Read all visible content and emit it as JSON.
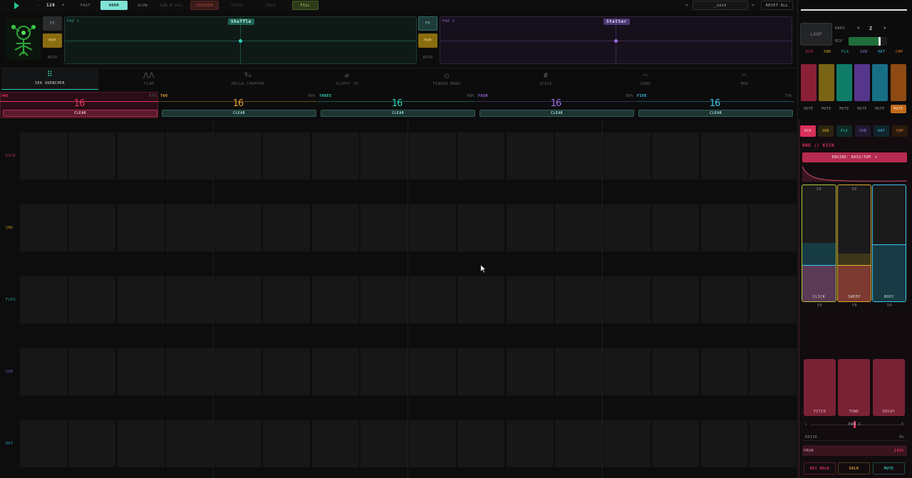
{
  "transport": {
    "play_icon": "play-icon",
    "bpm_minus": "-",
    "bpm": "120",
    "bpm_plus": "+",
    "speed": [
      "FAST",
      "NORM",
      "SLOW"
    ],
    "steps_info": "12& 8 eti.",
    "modes": [
      "CHOSHEN",
      "STROE",
      "PACK"
    ],
    "fill": "FILL",
    "preset_prev": "<",
    "preset_name": "_init",
    "preset_next": "<",
    "reset_all": "RESET ALL"
  },
  "fx": {
    "left": {
      "fx": "FX",
      "mom": "MOM",
      "auto": "AUTO",
      "pad_label": "PAD 1",
      "effect": "Shuffle"
    },
    "right": {
      "fx": "FX",
      "mom": "MOM",
      "auto": "AUTO",
      "pad_label": "PAD 2",
      "effect": "Stutter"
    }
  },
  "tabs": [
    {
      "label": "SEA QUENCHER",
      "icon": "grid-icon",
      "glyph": "⠿"
    },
    {
      "label": "FLAM",
      "icon": "flam-icon",
      "glyph": "⋀⋀"
    },
    {
      "label": "HELLA CHOPPER",
      "icon": "chopper-icon",
      "glyph": "ꟻ⫝"
    },
    {
      "label": "SLOPPY JO",
      "icon": "sloppy-icon",
      "glyph": "⇄"
    },
    {
      "label": "FINGER BANG",
      "icon": "circle-icon",
      "glyph": "○"
    },
    {
      "label": "SCALE",
      "icon": "hash-icon",
      "glyph": "#"
    },
    {
      "label": "SONG",
      "icon": "curve-icon",
      "glyph": "⌒"
    },
    {
      "label": "MOD",
      "icon": "mod-curve-icon",
      "glyph": "⌒"
    }
  ],
  "tracks": [
    {
      "name": "ONE",
      "steps": "16",
      "pct": "57%",
      "clear": "CLEAR",
      "color": "#e0325d"
    },
    {
      "name": "TWO",
      "steps": "16",
      "pct": "98%",
      "clear": "CLEAR",
      "color": "#e3a12e"
    },
    {
      "name": "THREE",
      "steps": "16",
      "pct": "98%",
      "clear": "CLEAR",
      "color": "#2fd0b4"
    },
    {
      "name": "FOUR",
      "steps": "16",
      "pct": "98%",
      "clear": "CLEAR",
      "color": "#9b6be2"
    },
    {
      "name": "FIVE",
      "steps": "16",
      "pct": "79%",
      "clear": "CLEAR",
      "color": "#3ec6e8"
    }
  ],
  "rows": [
    {
      "label": "KICK",
      "color": "#c03054"
    },
    {
      "label": "SNR",
      "color": "#b58a2a"
    },
    {
      "label": "FLEX",
      "color": "#26a890"
    },
    {
      "label": "SUB",
      "color": "#7b59b8"
    },
    {
      "label": "HAT",
      "color": "#2e9fc0"
    }
  ],
  "mixer": {
    "loop": "LOOP",
    "bars_label": "BARS",
    "bars_prev": "<",
    "bars": "2",
    "bars_next": ">",
    "mix_label": "MIX",
    "mix_level": 0.78,
    "voices": [
      {
        "label": "KCK",
        "color": "#e0325d",
        "swatch": "#8a2036",
        "mute": "MUTE"
      },
      {
        "label": "SNR",
        "color": "#e0a52e",
        "swatch": "#7a6416",
        "mute": "MUTE"
      },
      {
        "label": "FLX",
        "color": "#2fcfb4",
        "swatch": "#0f7c68",
        "mute": "MUTE"
      },
      {
        "label": "SUB",
        "color": "#a078e8",
        "swatch": "#56358c",
        "mute": "MUTE"
      },
      {
        "label": "HAT",
        "color": "#3ec6e8",
        "swatch": "#176f86",
        "mute": "MUTE"
      },
      {
        "label": "CHP",
        "color": "#f08a2e",
        "swatch": "#8e4a12",
        "mute": "MUTE"
      }
    ]
  },
  "editor": {
    "voice_tabs": [
      "KCK",
      "SNR",
      "FLX",
      "SUB",
      "HAT",
      "CHP"
    ],
    "title": "ONE // KICK",
    "engine": "ENGINE: BASS/TOM",
    "engine_chevron": "v",
    "layers": [
      {
        "label": "CLICK",
        "top_value": "50",
        "bottom_value": "50",
        "level": 0.5
      },
      {
        "label": "SWEEP",
        "top_value": "50",
        "bottom_value": "50",
        "level": 0.41
      },
      {
        "label": "BODY",
        "top_value": "",
        "bottom_value": "50",
        "level": 0.49
      }
    ],
    "knobs": [
      "PITCH",
      "TONE",
      "DECAY"
    ],
    "pan_left": "L",
    "pan_label": "PAN C",
    "pan_right": "R",
    "drive_label": "DRIVE",
    "drive_value": "0%",
    "prob_label": "PROB",
    "prob_value": "100%",
    "key_hold": "KEY HOLD",
    "solo": "SOLO",
    "mute": "MUTE"
  }
}
